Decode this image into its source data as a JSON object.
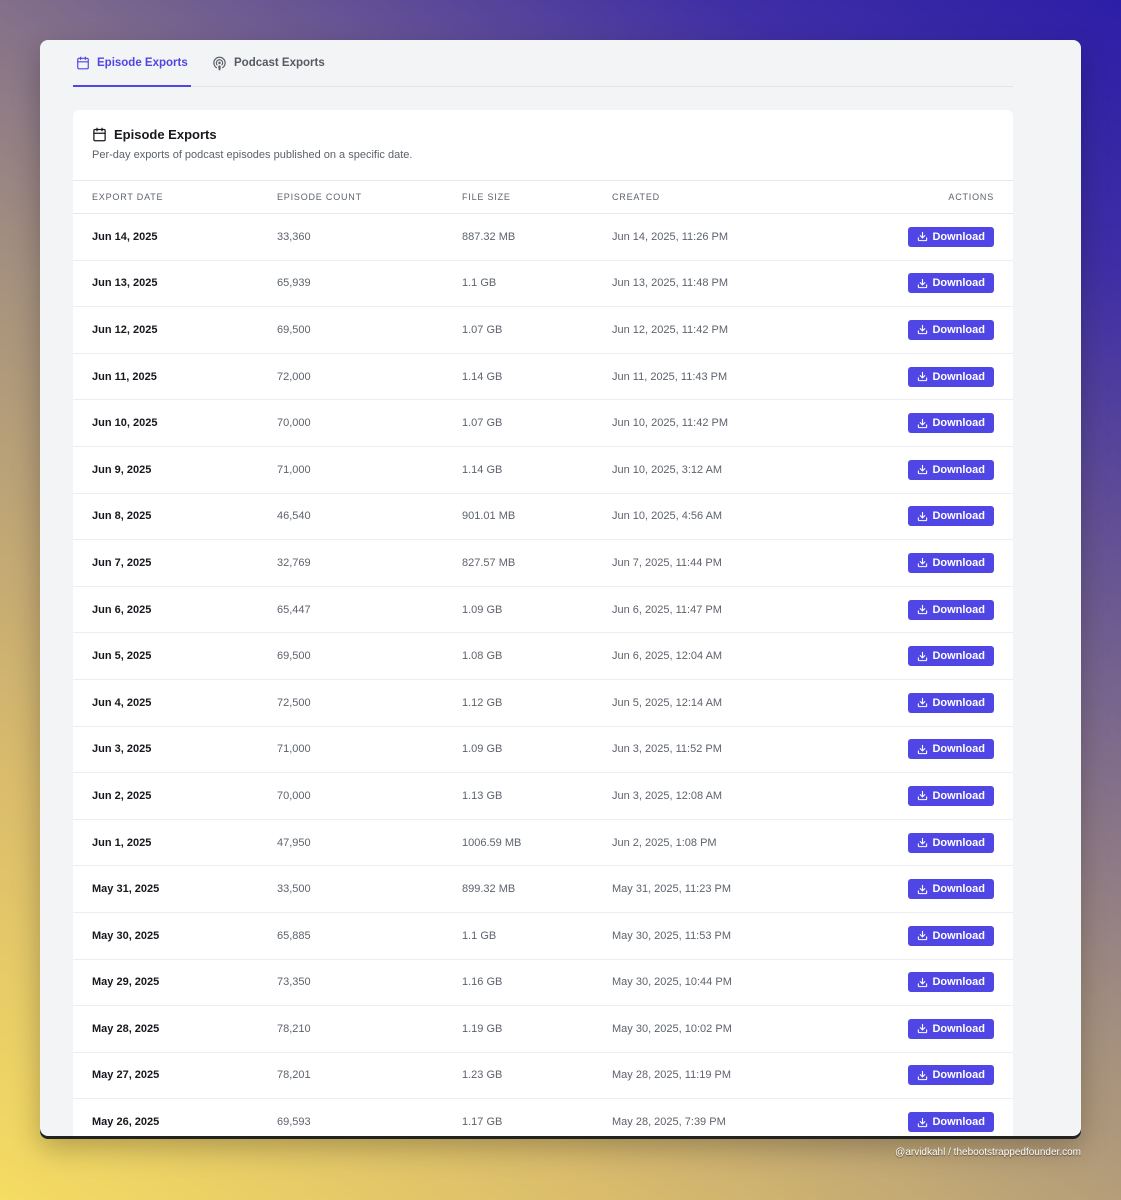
{
  "tabs": [
    {
      "label": "Episode Exports",
      "icon": "calendar-icon",
      "active": true
    },
    {
      "label": "Podcast Exports",
      "icon": "podcast-icon",
      "active": false
    }
  ],
  "card": {
    "title": "Episode Exports",
    "description": "Per-day exports of podcast episodes published on a specific date."
  },
  "table": {
    "headers": {
      "export_date": "EXPORT DATE",
      "episode_count": "EPISODE COUNT",
      "file_size": "FILE SIZE",
      "created": "CREATED",
      "actions": "ACTIONS"
    },
    "action_label": "Download",
    "rows": [
      {
        "date": "Jun 14, 2025",
        "count": "33,360",
        "size": "887.32 MB",
        "created": "Jun 14, 2025, 11:26 PM"
      },
      {
        "date": "Jun 13, 2025",
        "count": "65,939",
        "size": "1.1 GB",
        "created": "Jun 13, 2025, 11:48 PM"
      },
      {
        "date": "Jun 12, 2025",
        "count": "69,500",
        "size": "1.07 GB",
        "created": "Jun 12, 2025, 11:42 PM"
      },
      {
        "date": "Jun 11, 2025",
        "count": "72,000",
        "size": "1.14 GB",
        "created": "Jun 11, 2025, 11:43 PM"
      },
      {
        "date": "Jun 10, 2025",
        "count": "70,000",
        "size": "1.07 GB",
        "created": "Jun 10, 2025, 11:42 PM"
      },
      {
        "date": "Jun 9, 2025",
        "count": "71,000",
        "size": "1.14 GB",
        "created": "Jun 10, 2025, 3:12 AM"
      },
      {
        "date": "Jun 8, 2025",
        "count": "46,540",
        "size": "901.01 MB",
        "created": "Jun 10, 2025, 4:56 AM"
      },
      {
        "date": "Jun 7, 2025",
        "count": "32,769",
        "size": "827.57 MB",
        "created": "Jun 7, 2025, 11:44 PM"
      },
      {
        "date": "Jun 6, 2025",
        "count": "65,447",
        "size": "1.09 GB",
        "created": "Jun 6, 2025, 11:47 PM"
      },
      {
        "date": "Jun 5, 2025",
        "count": "69,500",
        "size": "1.08 GB",
        "created": "Jun 6, 2025, 12:04 AM"
      },
      {
        "date": "Jun 4, 2025",
        "count": "72,500",
        "size": "1.12 GB",
        "created": "Jun 5, 2025, 12:14 AM"
      },
      {
        "date": "Jun 3, 2025",
        "count": "71,000",
        "size": "1.09 GB",
        "created": "Jun 3, 2025, 11:52 PM"
      },
      {
        "date": "Jun 2, 2025",
        "count": "70,000",
        "size": "1.13 GB",
        "created": "Jun 3, 2025, 12:08 AM"
      },
      {
        "date": "Jun 1, 2025",
        "count": "47,950",
        "size": "1006.59 MB",
        "created": "Jun 2, 2025, 1:08 PM"
      },
      {
        "date": "May 31, 2025",
        "count": "33,500",
        "size": "899.32 MB",
        "created": "May 31, 2025, 11:23 PM"
      },
      {
        "date": "May 30, 2025",
        "count": "65,885",
        "size": "1.1 GB",
        "created": "May 30, 2025, 11:53 PM"
      },
      {
        "date": "May 29, 2025",
        "count": "73,350",
        "size": "1.16 GB",
        "created": "May 30, 2025, 10:44 PM"
      },
      {
        "date": "May 28, 2025",
        "count": "78,210",
        "size": "1.19 GB",
        "created": "May 30, 2025, 10:02 PM"
      },
      {
        "date": "May 27, 2025",
        "count": "78,201",
        "size": "1.23 GB",
        "created": "May 28, 2025, 11:19 PM"
      },
      {
        "date": "May 26, 2025",
        "count": "69,593",
        "size": "1.17 GB",
        "created": "May 28, 2025, 7:39 PM"
      }
    ]
  },
  "credit": "@arvidkahl / thebootstrappedfounder.com",
  "colors": {
    "accent": "#4f46e5",
    "text_strong": "#16181d",
    "text_muted": "#5d636c"
  }
}
